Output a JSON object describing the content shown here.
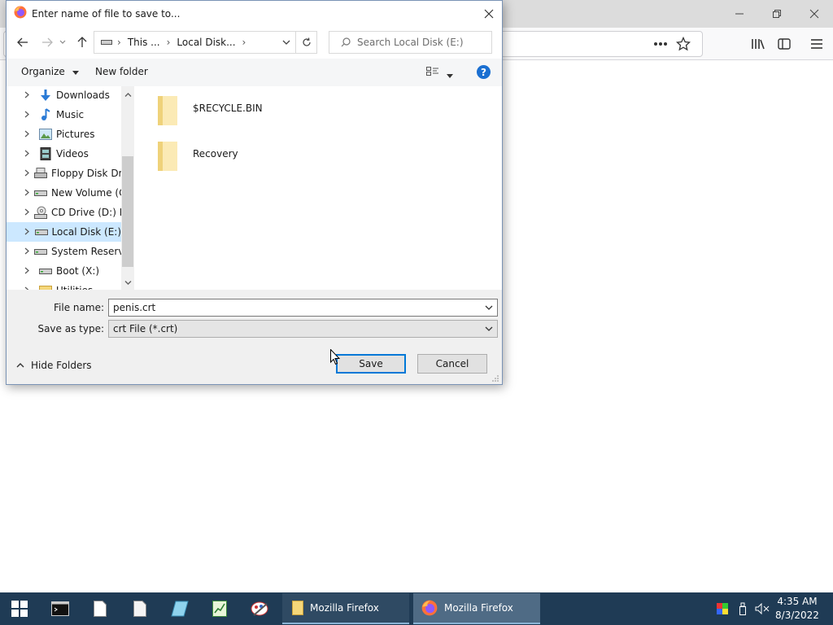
{
  "browser": {
    "window_controls": [
      "minimize",
      "restore",
      "close"
    ],
    "toolbar_icons": [
      "page-actions-icon",
      "bookmark-star-icon",
      "library-icon",
      "sidebar-icon",
      "menu-icon"
    ]
  },
  "dialog": {
    "title": "Enter name of file to save to...",
    "address": {
      "crumbs": [
        "This ...",
        "Local Disk..."
      ],
      "search_placeholder": "Search Local Disk (E:)"
    },
    "commands": {
      "organize": "Organize",
      "new_folder": "New folder"
    },
    "tree": [
      {
        "label": "Downloads",
        "icon": "downloads-icon",
        "selected": false
      },
      {
        "label": "Music",
        "icon": "music-icon",
        "selected": false
      },
      {
        "label": "Pictures",
        "icon": "pictures-icon",
        "selected": false
      },
      {
        "label": "Videos",
        "icon": "videos-icon",
        "selected": false
      },
      {
        "label": "Floppy Disk Dri",
        "icon": "floppy-drive-icon",
        "selected": false
      },
      {
        "label": "New Volume (C",
        "icon": "drive-icon",
        "selected": false
      },
      {
        "label": "CD Drive (D:) H",
        "icon": "cd-drive-icon",
        "selected": false
      },
      {
        "label": "Local Disk (E:)",
        "icon": "drive-icon",
        "selected": true
      },
      {
        "label": "System Reserve",
        "icon": "drive-icon",
        "selected": false
      },
      {
        "label": "Boot (X:)",
        "icon": "drive-icon",
        "selected": false
      },
      {
        "label": "Utilities",
        "icon": "folder-icon",
        "selected": false
      }
    ],
    "files": [
      {
        "name": "$RECYCLE.BIN"
      },
      {
        "name": "Recovery"
      }
    ],
    "file_name": {
      "label": "File name:",
      "value": "penis.crt"
    },
    "save_as_type": {
      "label": "Save as type:",
      "value": "crt File (*.crt)"
    },
    "hide_folders": "Hide Folders",
    "save_button": "Save",
    "cancel_button": "Cancel"
  },
  "taskbar": {
    "windows": [
      {
        "label": "Mozilla Firefox",
        "icon": "folder-icon",
        "active": false
      },
      {
        "label": "Mozilla Firefox",
        "icon": "firefox-icon",
        "active": true
      }
    ],
    "clock": {
      "time": "4:35 AM",
      "date": "8/3/2022"
    }
  },
  "colors": {
    "selection": "#cce8ff",
    "accent": "#0078d7",
    "taskbar": "#1f3b55",
    "folder": "#f5d77a"
  }
}
